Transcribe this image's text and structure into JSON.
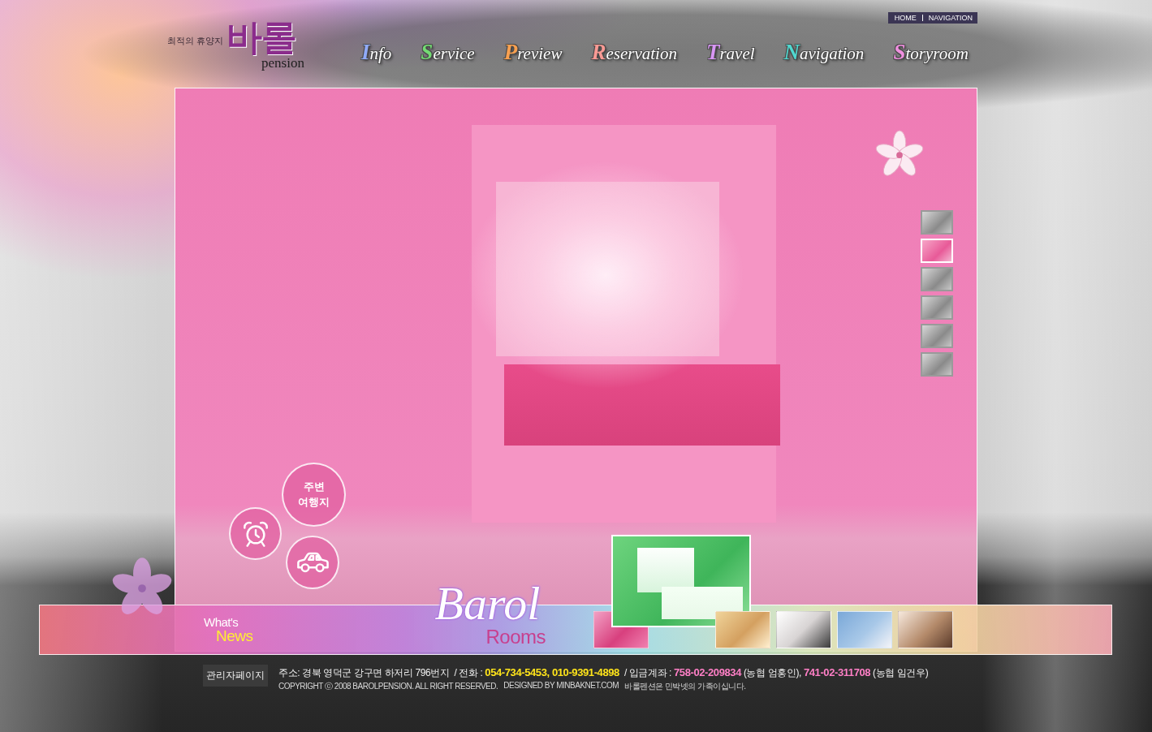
{
  "header": {
    "logo": {
      "tagline": "최적의 휴양지",
      "name": "바롤",
      "subtitle": "pension"
    },
    "top_links": [
      "HOME",
      "NAVIGATION"
    ],
    "nav": [
      {
        "label": "Info",
        "color": "#90aaf8"
      },
      {
        "label": "Service",
        "color": "#74dc74"
      },
      {
        "label": "Preview",
        "color": "#f8a050"
      },
      {
        "label": "Reservation",
        "color": "#f89a94"
      },
      {
        "label": "Travel",
        "color": "#d896f4"
      },
      {
        "label": "Navigation",
        "color": "#50d8d0"
      },
      {
        "label": "Storyroom",
        "color": "#f090e0"
      }
    ]
  },
  "gallery": {
    "thumbnails": [
      {
        "selected": false
      },
      {
        "selected": true
      },
      {
        "selected": false
      },
      {
        "selected": false
      },
      {
        "selected": false
      },
      {
        "selected": false
      }
    ]
  },
  "quick_links": [
    {
      "kind": "text",
      "label": "주변 여행지"
    },
    {
      "kind": "alarm"
    },
    {
      "kind": "car"
    }
  ],
  "rooms_bar": {
    "news": {
      "line_1": "What's",
      "line_2": "News"
    },
    "brand": {
      "script": "Barol",
      "title": "Rooms"
    },
    "thumbnails": [
      {
        "selected": false
      },
      {
        "selected": true
      },
      {
        "selected": false
      },
      {
        "selected": false
      },
      {
        "selected": false
      },
      {
        "selected": false
      }
    ]
  },
  "footer": {
    "admin_button": "관리자페이지",
    "contact": [
      {
        "kind": "address",
        "label": "주소:",
        "value": "경북 영덕군 강구면 하저리 796번지"
      },
      {
        "kind": "phone",
        "label": "/ 전화 :",
        "value": "054-734-5453, 010-9391-4898"
      },
      {
        "kind": "account",
        "label": "/ 입금계좌 :",
        "value": "**758-02-209834** (농협 엄홍인), **741-02-311708** (농협 임건우)"
      }
    ],
    "copyright": [
      "COPYRIGHT ⓒ 2008 BAROLPENSION. ALL RIGHT RESERVED.",
      "DESIGNED BY MINBAKNET.COM",
      "바롤펜션은 민박넷의 가족이십니다."
    ]
  }
}
